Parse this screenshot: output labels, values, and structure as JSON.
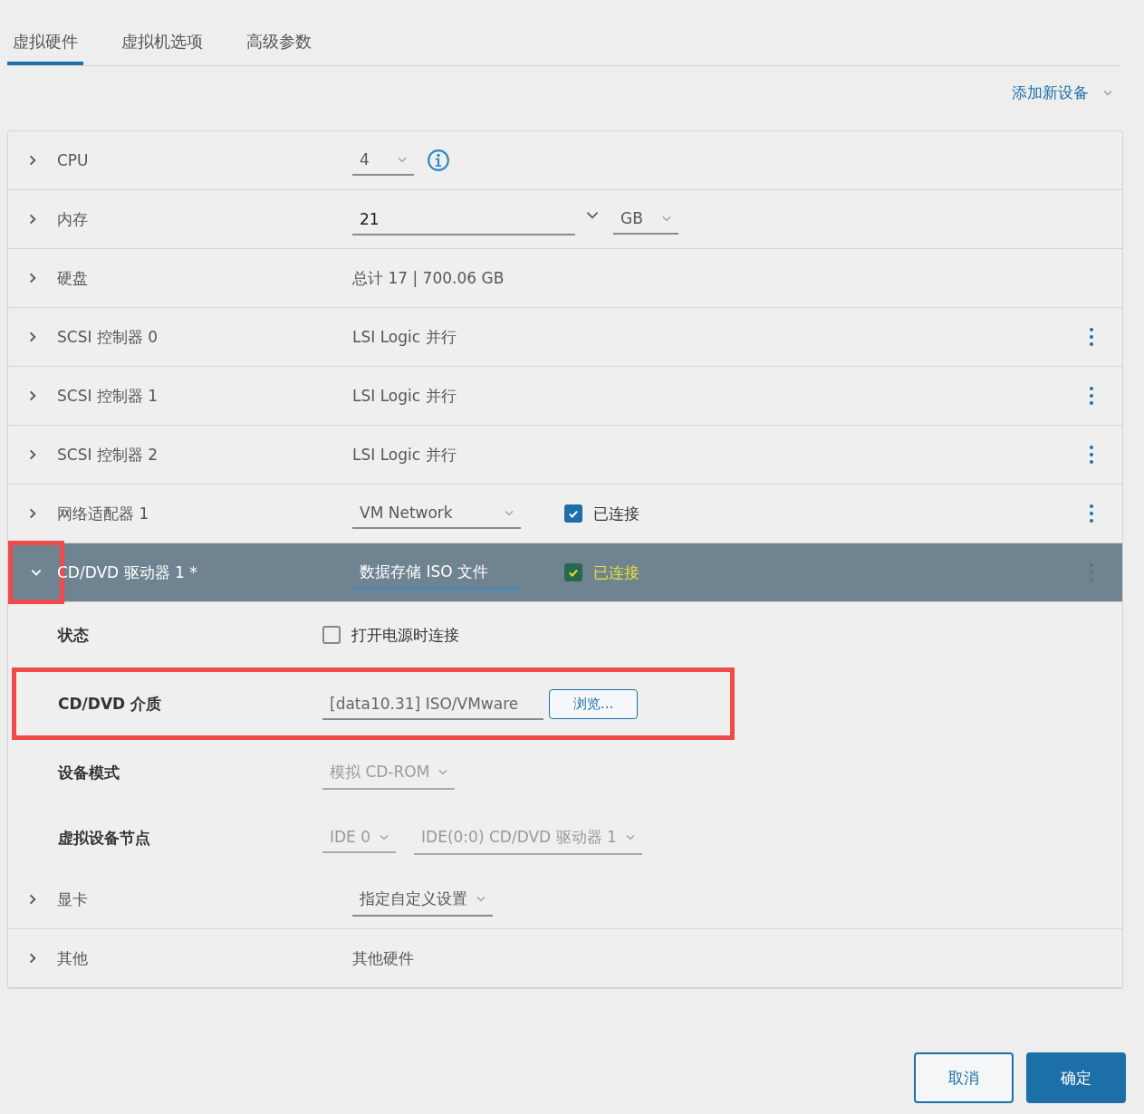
{
  "tabs": [
    {
      "label": "虚拟硬件",
      "selected": true
    },
    {
      "label": "虚拟机选项",
      "selected": false
    },
    {
      "label": "高级参数",
      "selected": false
    }
  ],
  "add_device": {
    "label": "添加新设备"
  },
  "rows": [
    {
      "kind": "cpu",
      "label": "CPU",
      "value": "4",
      "expanded": false,
      "selected": false,
      "annotated": false,
      "menu": false
    },
    {
      "kind": "memory",
      "label": "内存",
      "value": "21",
      "unit": "GB",
      "expanded": false,
      "selected": false,
      "annotated": false,
      "menu": false
    },
    {
      "kind": "text",
      "label": "硬盘",
      "value": "总计 17 | 700.06 GB",
      "expanded": false,
      "selected": false,
      "annotated": false,
      "menu": false
    },
    {
      "kind": "text",
      "label": "SCSI 控制器 0",
      "value": "LSI Logic 并行",
      "expanded": false,
      "selected": false,
      "annotated": false,
      "menu": true
    },
    {
      "kind": "text",
      "label": "SCSI 控制器 1",
      "value": "LSI Logic 并行",
      "expanded": false,
      "selected": false,
      "annotated": false,
      "menu": true
    },
    {
      "kind": "text",
      "label": "SCSI 控制器 2",
      "value": "LSI Logic 并行",
      "expanded": false,
      "selected": false,
      "annotated": false,
      "menu": true
    },
    {
      "kind": "device",
      "label": "网络适配器 1",
      "value": "VM Network",
      "connected": true,
      "connected_label": "已连接",
      "expanded": false,
      "selected": false,
      "annotated": false,
      "menu": true
    },
    {
      "kind": "device",
      "label": "CD/DVD 驱动器 1 *",
      "value": "数据存储 ISO 文件",
      "connected": true,
      "connected_label": "已连接",
      "expanded": true,
      "selected": true,
      "annotated": true,
      "menu": true,
      "details": [
        {
          "kind": "checkbox",
          "label": "状态",
          "checked": false,
          "text": "打开电源时连接",
          "annotated": false
        },
        {
          "kind": "file",
          "label": "CD/DVD 介质",
          "value": "[data10.31] ISO/VMware",
          "button": "浏览...",
          "annotated": true
        },
        {
          "kind": "selects",
          "label": "设备模式",
          "values": [
            "模拟 CD-ROM"
          ],
          "annotated": false
        },
        {
          "kind": "selects",
          "label": "虚拟设备节点",
          "values": [
            "IDE 0",
            "IDE(0:0) CD/DVD 驱动器 1"
          ],
          "annotated": false
        }
      ]
    },
    {
      "kind": "select",
      "label": "显卡",
      "value": "指定自定义设置",
      "expanded": false,
      "selected": false,
      "annotated": false,
      "menu": false
    },
    {
      "kind": "text",
      "label": "其他",
      "value": "其他硬件",
      "expanded": false,
      "selected": false,
      "annotated": false,
      "menu": false
    }
  ],
  "buttons": [
    {
      "label": "取消",
      "kind": "secondary"
    },
    {
      "label": "确定",
      "kind": "primary"
    }
  ]
}
